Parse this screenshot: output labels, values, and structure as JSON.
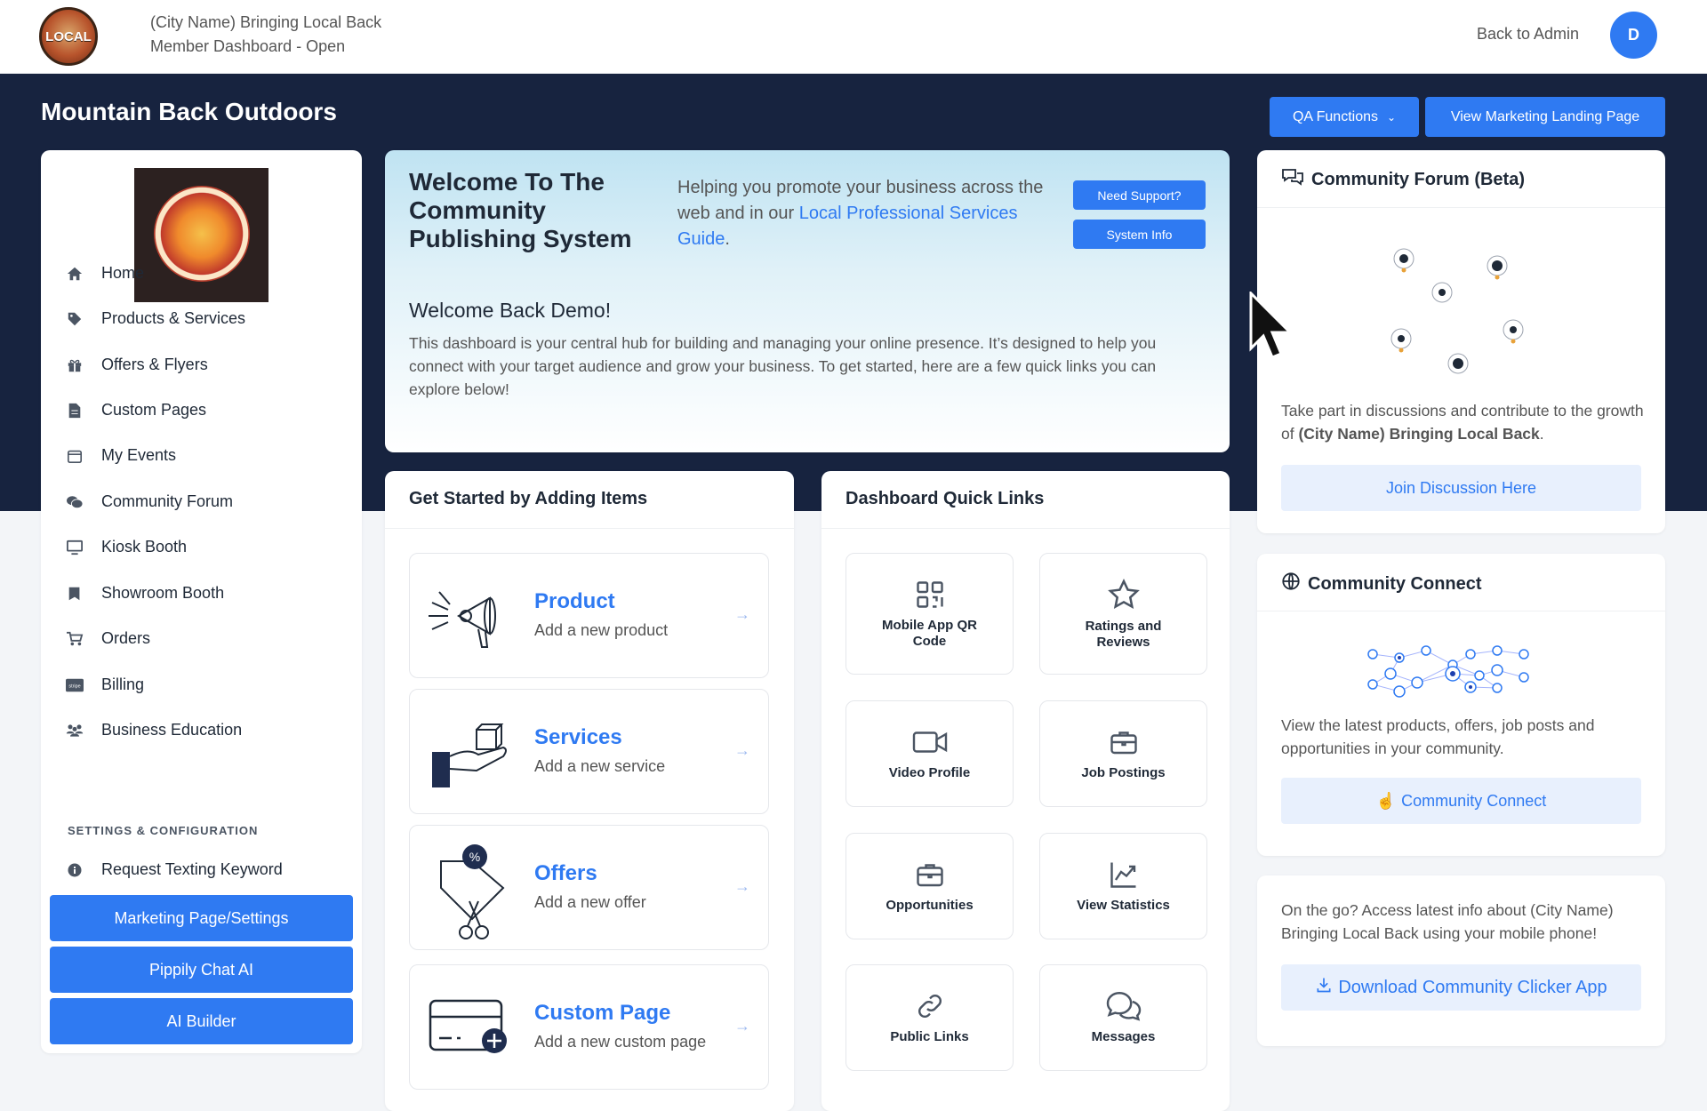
{
  "header": {
    "logo_text": "LOCAL",
    "title_line1": "(City Name) Bringing Local Back",
    "title_line2": "Member Dashboard - Open",
    "back_link": "Back to Admin",
    "avatar_initial": "D"
  },
  "banner": {
    "business_name": "Mountain Back Outdoors",
    "qa_button": "QA Functions",
    "landing_button": "View Marketing Landing Page"
  },
  "sidebar": {
    "items": [
      {
        "label": "Home",
        "icon": "home-icon"
      },
      {
        "label": "Products & Services",
        "icon": "tag-icon"
      },
      {
        "label": "Offers & Flyers",
        "icon": "gift-icon"
      },
      {
        "label": "Custom Pages",
        "icon": "file-icon"
      },
      {
        "label": "My Events",
        "icon": "calendar-icon"
      },
      {
        "label": "Community Forum",
        "icon": "comments-icon"
      },
      {
        "label": "Kiosk Booth",
        "icon": "monitor-icon"
      },
      {
        "label": "Showroom Booth",
        "icon": "book-icon"
      },
      {
        "label": "Orders",
        "icon": "cart-icon"
      },
      {
        "label": "Billing",
        "icon": "stripe-icon"
      },
      {
        "label": "Business Education",
        "icon": "users-icon"
      }
    ],
    "settings_heading": "SETTINGS & CONFIGURATION",
    "settings_item": "Request Texting Keyword",
    "buttons": [
      "Marketing Page/Settings",
      "Pippily Chat AI",
      "AI Builder"
    ]
  },
  "welcome": {
    "title": "Welcome To The Community Publishing System",
    "subtitle_pre": "Helping you promote your business across the web and in our ",
    "subtitle_link": "Local Professional Services Guide",
    "subtitle_post": ".",
    "support_button": "Need Support?",
    "info_button": "System Info",
    "greeting": "Welcome Back Demo!",
    "description": "This dashboard is your central hub for building and managing your online presence. It’s designed to help you connect with your target audience and grow your business. To get started, here are a few quick links you can explore below!"
  },
  "get_started": {
    "heading": "Get Started by Adding Items",
    "items": [
      {
        "title": "Product",
        "subtitle": "Add a new product",
        "icon": "megaphone-icon"
      },
      {
        "title": "Services",
        "subtitle": "Add a new service",
        "icon": "hand-box-icon"
      },
      {
        "title": "Offers",
        "subtitle": "Add a new offer",
        "icon": "coupon-scissors-icon"
      },
      {
        "title": "Custom Page",
        "subtitle": "Add a new custom page",
        "icon": "card-plus-icon"
      }
    ]
  },
  "quick_links": {
    "heading": "Dashboard Quick Links",
    "tiles": [
      {
        "label": "Mobile App QR Code",
        "icon": "qr-code-icon"
      },
      {
        "label": "Ratings and Reviews",
        "icon": "star-icon"
      },
      {
        "label": "Video Profile",
        "icon": "video-icon"
      },
      {
        "label": "Job Postings",
        "icon": "briefcase-icon"
      },
      {
        "label": "Opportunities",
        "icon": "briefcase-icon"
      },
      {
        "label": "View Statistics",
        "icon": "chart-icon"
      },
      {
        "label": "Public Links",
        "icon": "link-icon"
      },
      {
        "label": "Messages",
        "icon": "messages-icon"
      }
    ]
  },
  "forum": {
    "heading": "Community Forum (Beta)",
    "text_pre": "Take part in discussions and contribute to the growth of ",
    "text_bold": "(City Name) Bringing Local Back",
    "text_post": ".",
    "button": "Join Discussion Here"
  },
  "connect": {
    "heading": "Community Connect",
    "text": "View the latest products, offers, job posts and opportunities in your community.",
    "button": "Community Connect"
  },
  "mobile": {
    "text": "On the go? Access latest info about (City Name) Bringing Local Back using your mobile phone!",
    "button": "Download Community Clicker App"
  },
  "colors": {
    "primary": "#2f7af2",
    "navy": "#17233f",
    "light_button": "#e8f0fd"
  }
}
